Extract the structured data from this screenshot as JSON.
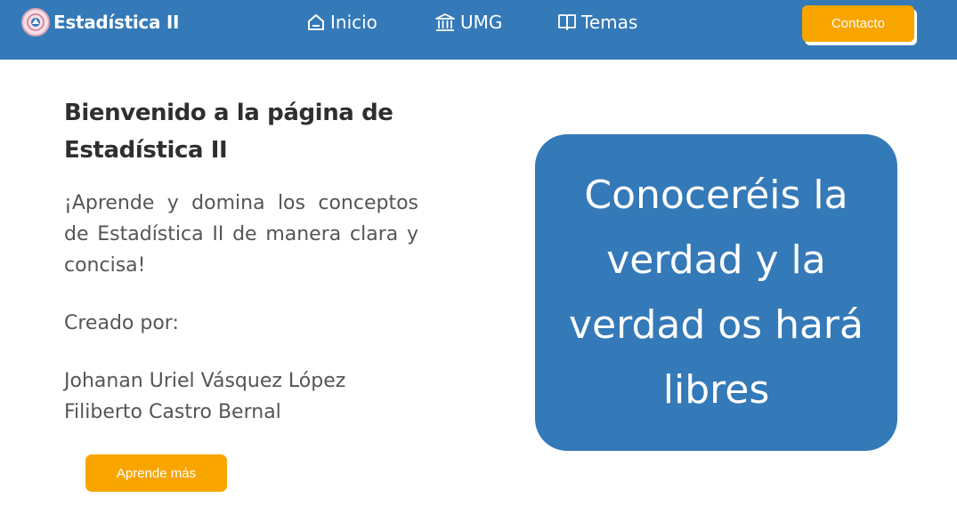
{
  "header": {
    "brand_title": "Estadística II",
    "logo_icon": "university-seal-icon",
    "nav": [
      {
        "label": "Inicio",
        "icon": "home-icon"
      },
      {
        "label": "UMG",
        "icon": "institution-icon"
      },
      {
        "label": "Temas",
        "icon": "open-book-icon"
      }
    ],
    "contact_label": "Contacto"
  },
  "main": {
    "title": "Bienvenido a la página de Estadística II",
    "intro": "¡Aprende y domina los conceptos de Estadística II de manera clara y concisa!",
    "created_by_label": "Creado por:",
    "authors": [
      "Johanan Uriel Vásquez López",
      "Filiberto Castro Bernal"
    ],
    "learn_more_label": "Aprende más"
  },
  "quote": {
    "text": "Conoceréis la verdad y la verdad os hará libres"
  },
  "colors": {
    "primary_blue": "#3479b8",
    "accent_orange": "#f9a500",
    "heading_text": "#2f2f2f",
    "body_text": "#555555"
  }
}
